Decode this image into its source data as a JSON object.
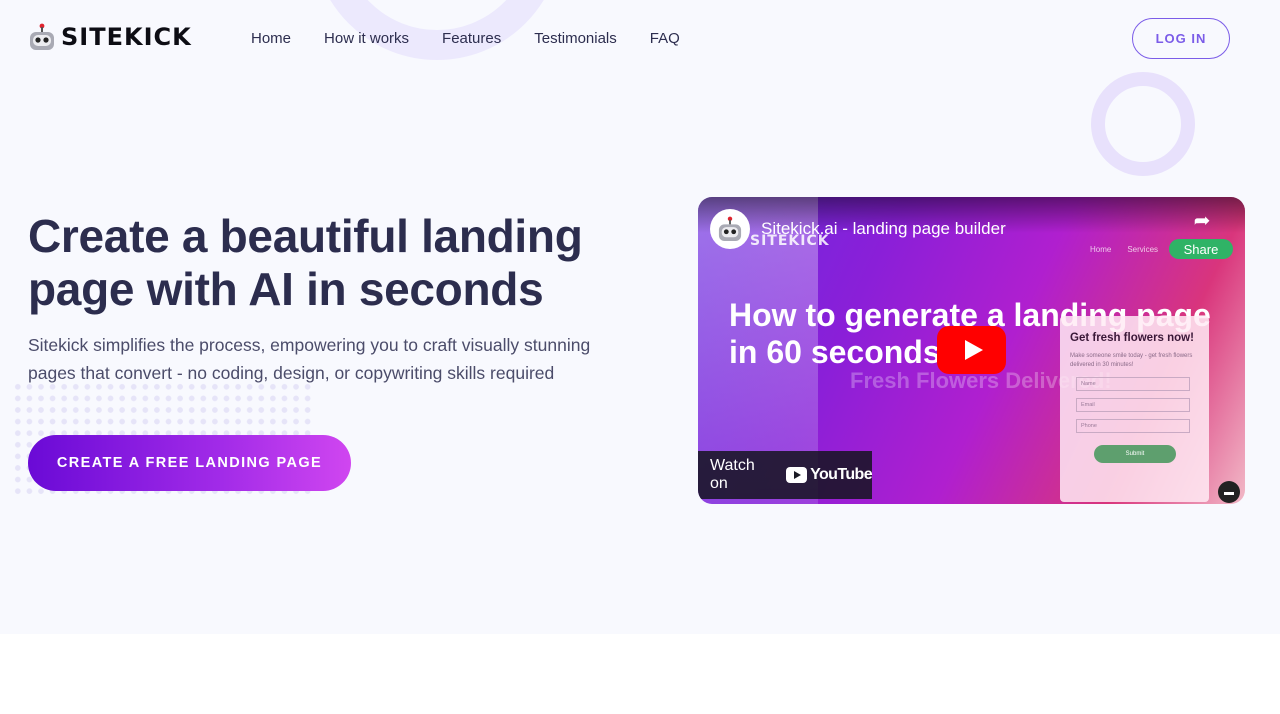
{
  "brand": {
    "name": "SITEKICK",
    "logo_icon": "robot-icon",
    "accent": "#7b5ce8"
  },
  "nav": {
    "items": [
      {
        "label": "Home"
      },
      {
        "label": "How it works"
      },
      {
        "label": "Features"
      },
      {
        "label": "Testimonials"
      },
      {
        "label": "FAQ"
      }
    ],
    "login_label": "LOG IN"
  },
  "hero": {
    "headline": "Create a beautiful landing page with AI in seconds",
    "subtext": "Sitekick simplifies the process, empowering you to craft visually stunning pages that convert - no coding, design, or copywriting skills required",
    "cta_label": "CREATE A FREE LANDING PAGE",
    "cta_gradient": [
      "#6a0ad6",
      "#d046f0"
    ]
  },
  "video": {
    "title": "Sitekick.ai - landing page builder",
    "share_label": "Share",
    "embedded_logo": "SITEKICK",
    "embedded_nav": [
      "Home",
      "Services"
    ],
    "overlay_text": "How to generate a landing page in 60 seconds",
    "ghost_text": "Fresh Flowers Delivered!",
    "form": {
      "title": "Get fresh flowers now!",
      "description": "Make someone smile today - get fresh flowers delivered in 30 minutes!",
      "fields": [
        "Name",
        "Email",
        "Phone"
      ],
      "submit_label": "Submit"
    },
    "watch_on_label": "Watch on",
    "youtube_label": "YouTube",
    "play_color": "#ff0000"
  }
}
